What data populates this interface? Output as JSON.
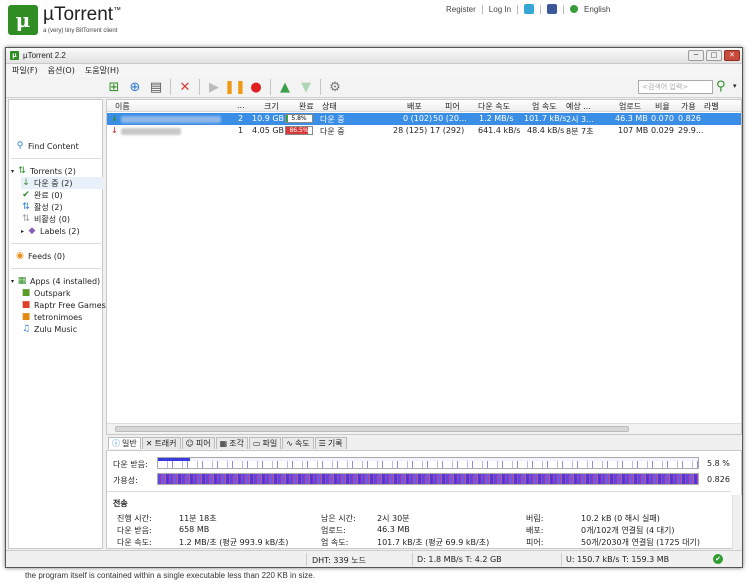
{
  "site": {
    "logo_glyph": "μ",
    "logo_name": "µTorrent",
    "logo_trademark": "™",
    "tagline": "a (very) tiny BitTorrent client",
    "links": {
      "register": "Register",
      "login": "Log In",
      "language": "English"
    },
    "caption": "the program itself is contained within a single executable less than 220 KB in size."
  },
  "window": {
    "title": "µTorrent 2.2",
    "controls": {
      "minimize": "─",
      "maximize": "□",
      "close": "✕"
    }
  },
  "menu": [
    "파일(F)",
    "옵션(O)",
    "도움말(H)"
  ],
  "search": {
    "placeholder": "<검색어 입력>"
  },
  "sidebar": {
    "find_content": "Find Content",
    "torrents": "Torrents (2)",
    "downloading": "다운 중 (2)",
    "completed": "완료 (0)",
    "active": "활성 (2)",
    "inactive": "비활성 (0)",
    "labels": "Labels (2)",
    "feeds": "Feeds (0)",
    "apps": "Apps (4 installed)",
    "app_items": [
      "Outspark",
      "Raptr Free Games",
      "tetronimoes",
      "Zulu Music"
    ]
  },
  "columns": {
    "name": "이름",
    "dots": "...",
    "size": "크기",
    "done": "완료",
    "status": "상태",
    "seeds": "배포",
    "peers": "피어",
    "down_speed": "다운 속도",
    "up_speed": "업 속도",
    "eta": "예상 ...",
    "uploaded": "업로드",
    "ratio": "비율",
    "avail": "가용",
    "label": "라벨"
  },
  "torrents": [
    {
      "num": "2",
      "size": "10.9 GB",
      "progress_text": "5.8%",
      "progress": 0.058,
      "status": "다운 중",
      "seeds": "0 (102)",
      "peers": "50 (20...",
      "down": "1.2 MB/s",
      "up": "101.7 kB/s",
      "eta": "2시 3...",
      "uploaded": "46.3 MB",
      "ratio": "0.070",
      "avail": "0.826"
    },
    {
      "num": "1",
      "size": "4.05 GB",
      "progress_text": "86.5%",
      "progress": 0.865,
      "status": "다운 중",
      "seeds": "28 (125)",
      "peers": "17 (292)",
      "down": "641.4 kB/s",
      "up": "48.4 kB/s",
      "eta": "8분 7초",
      "uploaded": "107 MB",
      "ratio": "0.029",
      "avail": "29.9..."
    }
  ],
  "tabs": [
    "일반",
    "트래커",
    "피어",
    "조각",
    "파일",
    "속도",
    "기록"
  ],
  "general": {
    "downloaded_label": "다운 받음:",
    "downloaded_pct": "5.8 %",
    "availability_label": "가용성:",
    "availability_value": "0.826",
    "transfer_header": "전송",
    "fields": [
      {
        "k": "진행 시간:",
        "v": "11분 18초"
      },
      {
        "k": "다운 받음:",
        "v": "658 MB"
      },
      {
        "k": "다운 속도:",
        "v": "1.2 MB/초 (평균 993.9 kB/초)"
      },
      {
        "k": "남은 시간:",
        "v": "2시 30분"
      },
      {
        "k": "업로드:",
        "v": "46.3 MB"
      },
      {
        "k": "업 속도:",
        "v": "101.7 kB/초 (평균 69.9 kB/초)"
      },
      {
        "k": "버림:",
        "v": "10.2 kB (0 해시 실패)"
      },
      {
        "k": "배포:",
        "v": "0개/102개 연결됨 (4 대기)"
      },
      {
        "k": "피어:",
        "v": "50개/2030개 연결됨 (1725 대기)"
      }
    ]
  },
  "status": {
    "dht": "DHT: 339 노드",
    "down": "D: 1.8 MB/s T: 4.2 GB",
    "up": "U: 150.7 kB/s T: 159.3 MB"
  },
  "colors": {
    "brand": "#2f8d24",
    "selection": "#3a8ee6",
    "progress_green": "#3aa14a",
    "progress_red": "#d63a3a"
  }
}
